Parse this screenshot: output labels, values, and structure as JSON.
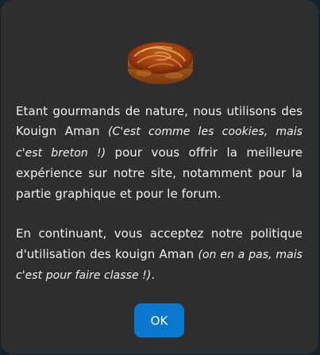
{
  "dialog": {
    "image": "kouign-amann-pastry",
    "paragraph1": {
      "part1": "Etant gourmands de nature, nous utilisons des Kouign Aman ",
      "aside": "(C'est comme les cookies, mais c'est breton !)",
      "part2": " pour vous offrir la meilleure expérience sur notre site, notamment pour la partie graphique et pour le forum."
    },
    "paragraph2": {
      "part1": "En continuant, vous acceptez notre politique d'utilisation des kouign Aman ",
      "aside": "(on en a pas, mais c'est pour faire classe !)",
      "part2": "."
    },
    "ok_label": "OK",
    "colors": {
      "panel": "#2e2e2e",
      "button": "#0a78cf",
      "text": "#f1f1f1"
    }
  }
}
